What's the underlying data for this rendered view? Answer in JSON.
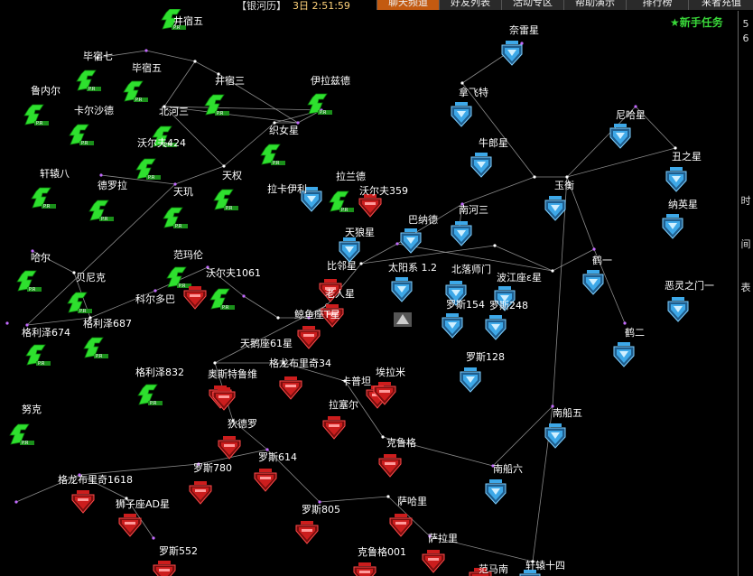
{
  "topbar": {
    "tag": "【银河历】",
    "time": "3日 2:51:59",
    "tabs": [
      {
        "label": "聊天频道",
        "active": true
      },
      {
        "label": "好友列表",
        "active": false
      },
      {
        "label": "活动专区",
        "active": false
      },
      {
        "label": "帮助演示",
        "active": false
      },
      {
        "label": "排行榜",
        "active": false
      },
      {
        "label": "来者充值",
        "active": false
      }
    ]
  },
  "quest_label": "★新手任务",
  "sidebar": {
    "items": [
      "5",
      "6",
      "时",
      "间",
      "表"
    ]
  },
  "colors": {
    "green": "#2ee02e",
    "blue": "#3da8e8",
    "red": "#cc1d1d",
    "line": "#b8b8b8",
    "accent": "#c35a10"
  },
  "nodes": [
    {
      "name": "井宿五",
      "type": "green"
    },
    {
      "name": "毕宿七",
      "type": "green"
    },
    {
      "name": "毕宿五",
      "type": "green"
    },
    {
      "name": "井宿三",
      "type": "green"
    },
    {
      "name": "伊拉兹德",
      "type": "green"
    },
    {
      "name": "鲁内尔",
      "type": "green"
    },
    {
      "name": "卡尔沙德",
      "type": "green"
    },
    {
      "name": "北河三",
      "type": "green"
    },
    {
      "name": "沃尔夫424",
      "type": "green"
    },
    {
      "name": "织女星",
      "type": "green"
    },
    {
      "name": "轩辕八",
      "type": "green"
    },
    {
      "name": "德罗拉",
      "type": "green"
    },
    {
      "name": "天权",
      "type": "green"
    },
    {
      "name": "天玑",
      "type": "green"
    },
    {
      "name": "拉卡伊利",
      "type": "blue"
    },
    {
      "name": "拉兰德",
      "type": "green"
    },
    {
      "name": "沃尔夫359",
      "type": "red"
    },
    {
      "name": "哈尔",
      "type": "green"
    },
    {
      "name": "范玛伦",
      "type": "green"
    },
    {
      "name": "贝尼克",
      "type": "green"
    },
    {
      "name": "科尔多巴",
      "type": "red"
    },
    {
      "name": "沃尔夫1061",
      "type": "green"
    },
    {
      "name": "比邻星",
      "type": "red"
    },
    {
      "name": "老人星",
      "type": "red"
    },
    {
      "name": "格利泽674",
      "type": "green"
    },
    {
      "name": "格利泽687",
      "type": "green"
    },
    {
      "name": "鲸鱼座T星",
      "type": "red"
    },
    {
      "name": "天鹅座61星",
      "type": "red"
    },
    {
      "name": "格利泽832",
      "type": "green"
    },
    {
      "name": "奥斯特鲁维",
      "type": "red"
    },
    {
      "name": "格龙布里奇34",
      "type": "red"
    },
    {
      "name": "卡普坦",
      "type": "red"
    },
    {
      "name": "埃拉米",
      "type": "red"
    },
    {
      "name": "拉塞尔",
      "type": "red"
    },
    {
      "name": "努克",
      "type": "green"
    },
    {
      "name": "狄德罗",
      "type": "red"
    },
    {
      "name": "克鲁格",
      "type": "red"
    },
    {
      "name": "罗斯614",
      "type": "red"
    },
    {
      "name": "罗斯780",
      "type": "red"
    },
    {
      "name": "格龙布里奇1618",
      "type": "red"
    },
    {
      "name": "狮子座AD星",
      "type": "red"
    },
    {
      "name": "罗斯805",
      "type": "red"
    },
    {
      "name": "萨哈里",
      "type": "red"
    },
    {
      "name": "罗斯552",
      "type": "red"
    },
    {
      "name": "克鲁格001",
      "type": "red"
    },
    {
      "name": "萨拉里",
      "type": "red"
    },
    {
      "name": "范马南",
      "type": "red"
    },
    {
      "name": "奈雷星",
      "type": "blue"
    },
    {
      "name": "拿飞特",
      "type": "blue"
    },
    {
      "name": "尼哈星",
      "type": "blue"
    },
    {
      "name": "牛郎星",
      "type": "blue"
    },
    {
      "name": "玉衡",
      "type": "blue"
    },
    {
      "name": "丑之星",
      "type": "blue"
    },
    {
      "name": "纳英星",
      "type": "blue"
    },
    {
      "name": "巴纳德",
      "type": "blue"
    },
    {
      "name": "南河三",
      "type": "blue"
    },
    {
      "name": "天狼星",
      "type": "blue"
    },
    {
      "name": "太阳系 1.2",
      "type": "blue"
    },
    {
      "name": "北落师门",
      "type": "blue"
    },
    {
      "name": "波江座ε星",
      "type": "blue"
    },
    {
      "name": "鹤一",
      "type": "blue"
    },
    {
      "name": "恶灵之门一",
      "type": "blue"
    },
    {
      "name": "罗斯154",
      "type": "blue"
    },
    {
      "name": "罗斯248",
      "type": "blue"
    },
    {
      "name": "鹤二",
      "type": "blue"
    },
    {
      "name": "罗斯128",
      "type": "blue"
    },
    {
      "name": "南船五",
      "type": "blue"
    },
    {
      "name": "南船六",
      "type": "blue"
    },
    {
      "name": "轩辕十四",
      "type": "blue"
    }
  ]
}
